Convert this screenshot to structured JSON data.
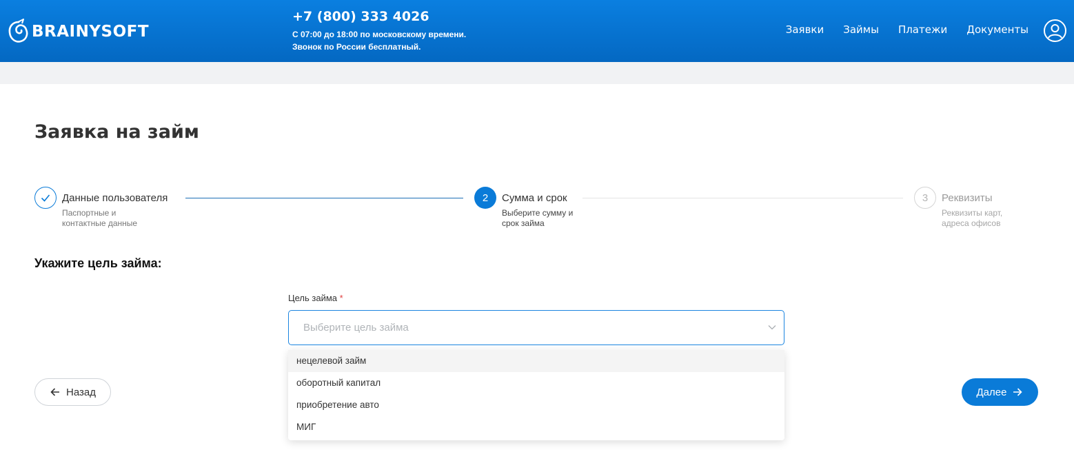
{
  "header": {
    "logo_text": "BRAINYSOFT",
    "phone": "+7 (800) 333 4026",
    "hours": "С 07:00 до 18:00 по московскому времени.",
    "free_call": "Звонок по России бесплатный.",
    "nav": [
      "Заявки",
      "Займы",
      "Платежи",
      "Документы"
    ],
    "user_icon": "user-circle-icon"
  },
  "page": {
    "title": "Заявка на займ"
  },
  "stepper": {
    "steps": [
      {
        "status": "done",
        "number": "1",
        "title": "Данные пользователя",
        "description": "Паспортные и контактные данные"
      },
      {
        "status": "active",
        "number": "2",
        "title": "Сумма и срок",
        "description": "Выберите сумму и срок займа"
      },
      {
        "status": "todo",
        "number": "3",
        "title": "Реквизиты",
        "description": "Реквизиты карт, адреса офисов"
      }
    ]
  },
  "form": {
    "section_title": "Укажите цель займа:",
    "purpose_label": "Цель займа",
    "required_mark": "*",
    "purpose_placeholder": "Выберите цель займа",
    "options": [
      "нецелевой займ",
      "оборотный капитал",
      "приобретение авто",
      "МИГ"
    ]
  },
  "buttons": {
    "back": "Назад",
    "next": "Далее"
  },
  "colors": {
    "brand": "#0a7bd8",
    "header_start": "#0a7fe0",
    "header_end": "#0468c2",
    "inactive": "#b5b5b5"
  }
}
